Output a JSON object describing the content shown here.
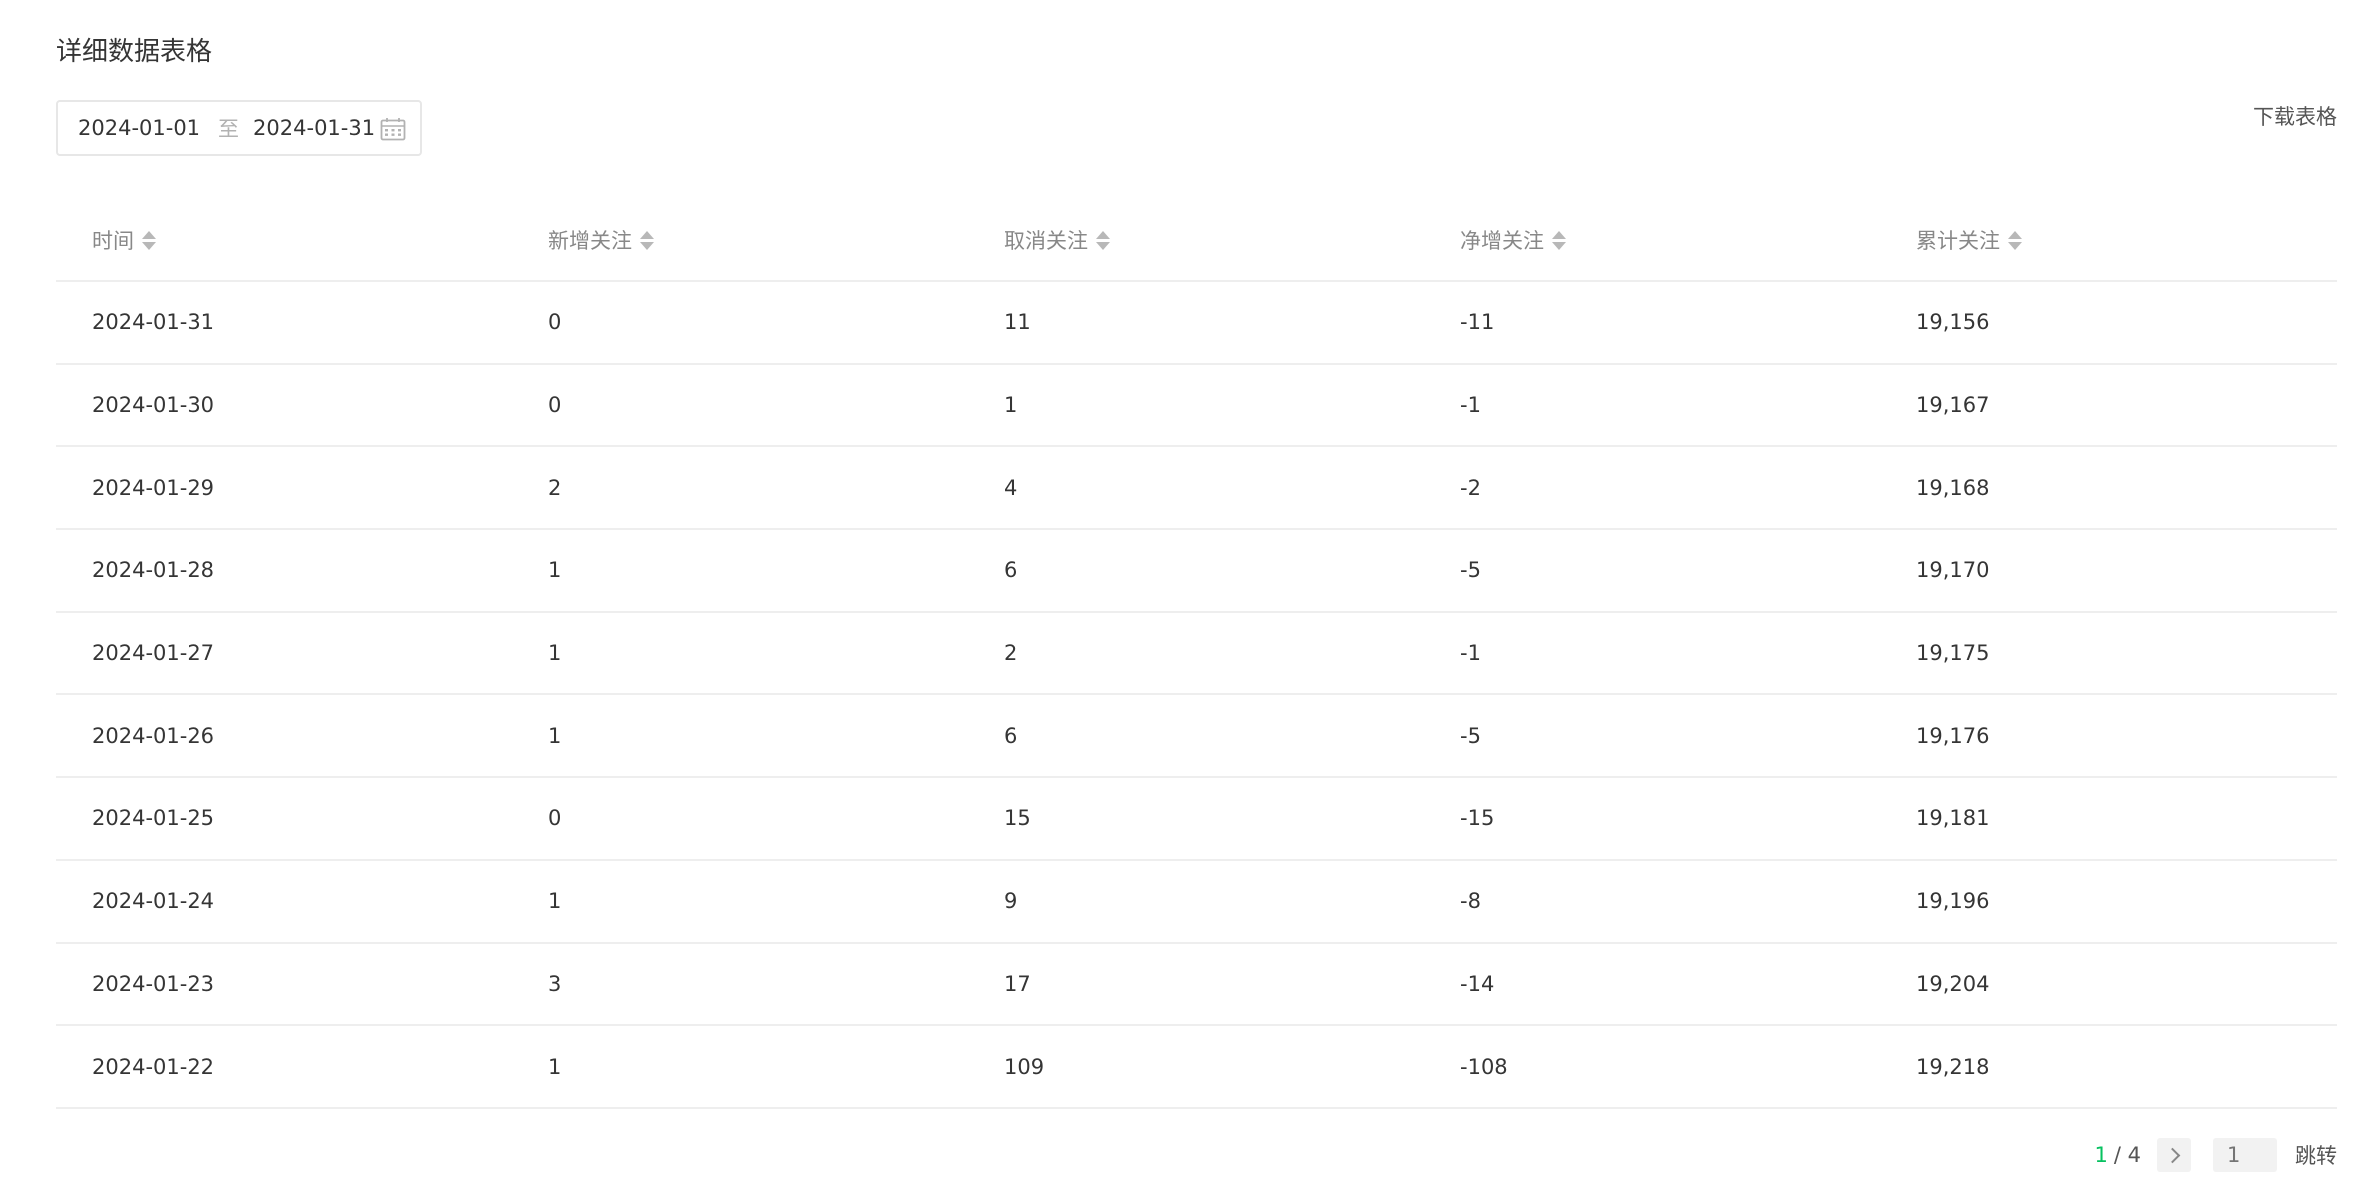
{
  "section": {
    "title": "详细数据表格"
  },
  "date_range": {
    "start": "2024-01-01",
    "separator": "至",
    "end": "2024-01-31",
    "icon": "calendar-icon"
  },
  "download_label": "下载表格",
  "table": {
    "headers": [
      "时间",
      "新增关注",
      "取消关注",
      "净增关注",
      "累计关注"
    ],
    "rows": [
      [
        "2024-01-31",
        "0",
        "11",
        "-11",
        "19,156"
      ],
      [
        "2024-01-30",
        "0",
        "1",
        "-1",
        "19,167"
      ],
      [
        "2024-01-29",
        "2",
        "4",
        "-2",
        "19,168"
      ],
      [
        "2024-01-28",
        "1",
        "6",
        "-5",
        "19,170"
      ],
      [
        "2024-01-27",
        "1",
        "2",
        "-1",
        "19,175"
      ],
      [
        "2024-01-26",
        "1",
        "6",
        "-5",
        "19,176"
      ],
      [
        "2024-01-25",
        "0",
        "15",
        "-15",
        "19,181"
      ],
      [
        "2024-01-24",
        "1",
        "9",
        "-8",
        "19,196"
      ],
      [
        "2024-01-23",
        "3",
        "17",
        "-14",
        "19,204"
      ],
      [
        "2024-01-22",
        "1",
        "109",
        "-108",
        "19,218"
      ]
    ]
  },
  "pagination": {
    "current": "1",
    "total_text": "/ 4",
    "input_placeholder": "1",
    "jump_label": "跳转"
  },
  "colors": {
    "accent": "#07c160",
    "border": "#eeeeee"
  }
}
